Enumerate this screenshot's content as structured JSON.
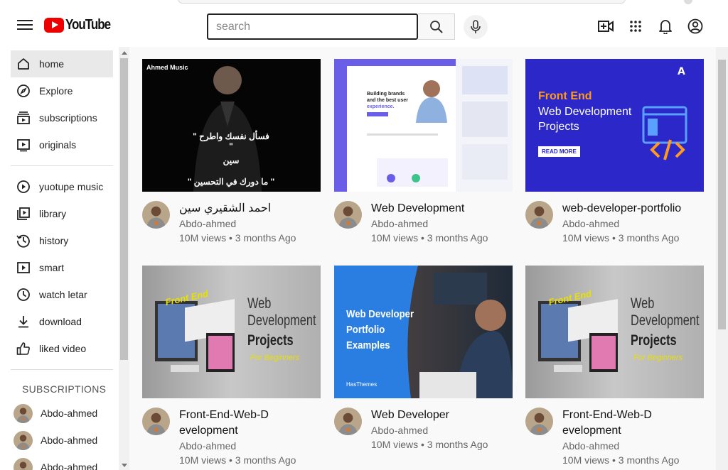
{
  "header": {
    "logo_text": "YouTube",
    "search_placeholder": "search"
  },
  "sidebar": {
    "main_items": [
      {
        "label": "home",
        "icon": "home-icon"
      },
      {
        "label": "Explore",
        "icon": "compass-icon"
      },
      {
        "label": "subscriptions",
        "icon": "subscriptions-icon"
      },
      {
        "label": "originals",
        "icon": "originals-icon"
      }
    ],
    "library_items": [
      {
        "label": "yuotupe music",
        "icon": "music-icon"
      },
      {
        "label": "library",
        "icon": "library-icon"
      },
      {
        "label": "history",
        "icon": "history-icon"
      },
      {
        "label": "smart",
        "icon": "smart-icon"
      },
      {
        "label": "watch letar",
        "icon": "clock-icon"
      },
      {
        "label": "download",
        "icon": "download-icon"
      },
      {
        "label": "liked video",
        "icon": "thumbs-up-icon"
      }
    ],
    "subscriptions_heading": "SUBSCRIPTIONS",
    "subscriptions": [
      "Abdo-ahmed",
      "Abdo-ahmed",
      "Abdo-ahmed"
    ]
  },
  "videos": [
    {
      "title": "احمد الشقيري سين",
      "channel": "Abdo-ahmed",
      "stats": "10M views • 3 months Ago",
      "thumb": {
        "kind": "portrait",
        "corner_text": "Ahmed Music",
        "lines": [
          "\" فسأل نفسك واطرح \"",
          "سين",
          "\" ما دورك في التحسين \""
        ]
      }
    },
    {
      "title": "Web Development",
      "channel": "Abdo-ahmed",
      "stats": "10M views • 3 months Ago",
      "thumb": {
        "kind": "mockup",
        "lines": [
          "Building brands",
          "and the best user",
          "experience."
        ]
      }
    },
    {
      "title": "web-developer-portfolio",
      "channel": "Abdo-ahmed",
      "stats": "10M views • 3 months Ago",
      "thumb": {
        "kind": "blue",
        "lines": [
          "Front End",
          "Web Development",
          "Projects"
        ],
        "button": "READ MORE"
      }
    },
    {
      "title": "Front-End-Web-Development",
      "channel": "Abdo-ahmed",
      "stats": "10M views • 3 months Ago",
      "thumb": {
        "kind": "gray",
        "lines": [
          "Web",
          "Development",
          "Projects",
          "For Beginners",
          "Front End"
        ]
      }
    },
    {
      "title": "Web Developer",
      "channel": "Abdo-ahmed",
      "stats": "10M views • 3 months Ago",
      "thumb": {
        "kind": "photo",
        "lines": [
          "Web Developer",
          "Portfolio",
          "Examples"
        ],
        "brand": "HasThemes"
      }
    },
    {
      "title": "Front-End-Web-Development",
      "channel": "Abdo-ahmed",
      "stats": "10M views • 3 months Ago",
      "thumb": {
        "kind": "gray",
        "lines": [
          "Web",
          "Development",
          "Projects",
          "For Beginners",
          "Front End"
        ]
      }
    }
  ]
}
